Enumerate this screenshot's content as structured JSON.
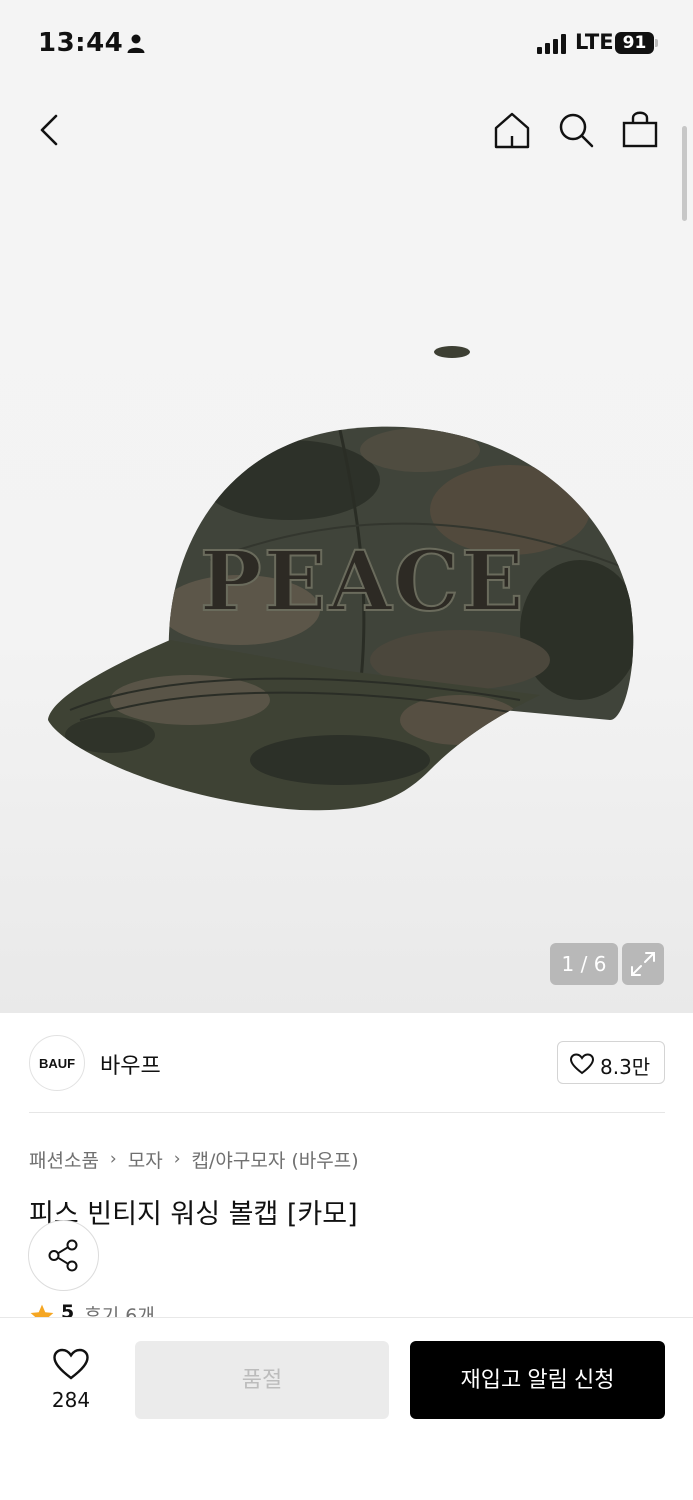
{
  "status_bar": {
    "time": "13:44",
    "network": "LTE",
    "battery": "91"
  },
  "gallery": {
    "counter": "1 / 6",
    "current": 1,
    "total": 6
  },
  "brand": {
    "logo_text": "BAUF",
    "name": "바우프",
    "likes": "8.3만"
  },
  "breadcrumb": [
    "패션소품",
    "모자",
    "캡/야구모자 (바우프)"
  ],
  "product": {
    "title": "피스 빈티지 워싱 볼캡 [카모]",
    "rating": "5",
    "reviews": "후기 6개"
  },
  "bottom_bar": {
    "wish_count": "284",
    "soldout_label": "품절",
    "restock_label": "재입고 알림 신청"
  },
  "colors": {
    "accent_black": "#000000",
    "star": "#f5a623",
    "muted": "#707070"
  }
}
